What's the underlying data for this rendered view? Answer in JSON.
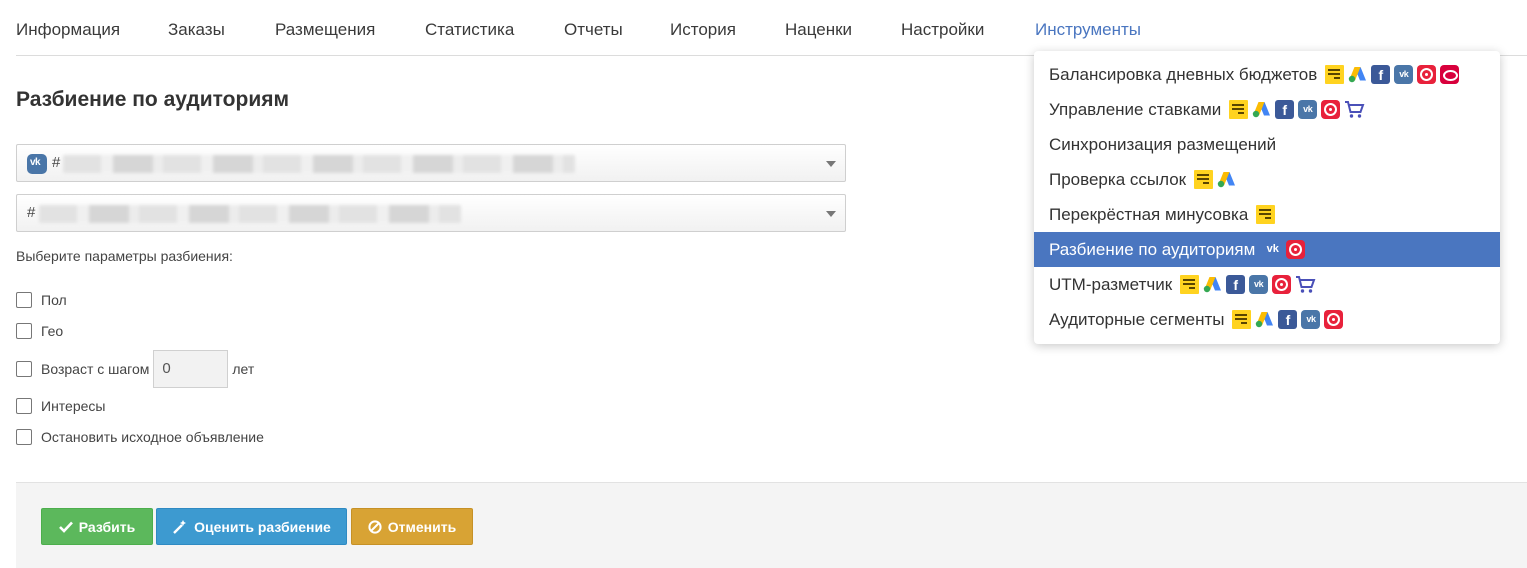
{
  "tabs": [
    {
      "label": "Информация"
    },
    {
      "label": "Заказы"
    },
    {
      "label": "Размещения"
    },
    {
      "label": "Статистика"
    },
    {
      "label": "Отчеты"
    },
    {
      "label": "История"
    },
    {
      "label": "Наценки"
    },
    {
      "label": "Настройки"
    },
    {
      "label": "Инструменты",
      "active": true
    }
  ],
  "page": {
    "title": "Разбиение по аудиториям",
    "select1_prefix": "#",
    "select2_prefix": "#",
    "params_label": "Выберите параметры разбиения:",
    "options": {
      "gender": "Пол",
      "geo": "Гео",
      "age_prefix": "Возраст с шагом",
      "age_value": "0",
      "age_suffix": "лет",
      "interests": "Интересы",
      "stop_original": "Остановить исходное объявление"
    }
  },
  "buttons": {
    "split": "Разбить",
    "estimate": "Оценить разбиение",
    "cancel": "Отменить"
  },
  "menu": {
    "items": [
      {
        "label": "Балансировка дневных бюджетов",
        "icons": [
          "yandex-direct-icon",
          "google-ads-icon",
          "facebook-icon",
          "vk-icon",
          "mytarget-icon",
          "ok-icon"
        ]
      },
      {
        "label": "Управление ставками",
        "icons": [
          "yandex-direct-icon",
          "google-ads-icon",
          "facebook-icon",
          "vk-icon",
          "mytarget-icon",
          "cart-icon"
        ]
      },
      {
        "label": "Синхронизация размещений",
        "icons": []
      },
      {
        "label": "Проверка ссылок",
        "icons": [
          "yandex-direct-icon",
          "google-ads-icon"
        ]
      },
      {
        "label": "Перекрёстная минусовка",
        "icons": [
          "yandex-direct-icon"
        ]
      },
      {
        "label": "Разбиение по аудиториям",
        "icons": [
          "vk-icon",
          "mytarget-icon"
        ],
        "active": true
      },
      {
        "label": "UTM-разметчик",
        "icons": [
          "yandex-direct-icon",
          "google-ads-icon",
          "facebook-icon",
          "vk-icon",
          "mytarget-icon",
          "cart-icon"
        ]
      },
      {
        "label": "Аудиторные сегменты",
        "icons": [
          "yandex-direct-icon",
          "google-ads-icon",
          "facebook-icon",
          "vk-icon",
          "mytarget-icon"
        ]
      }
    ]
  },
  "colors": {
    "accent": "#4a76c0",
    "success": "#5cb85c",
    "info": "#3d9ad0",
    "warning": "#d8a334"
  }
}
